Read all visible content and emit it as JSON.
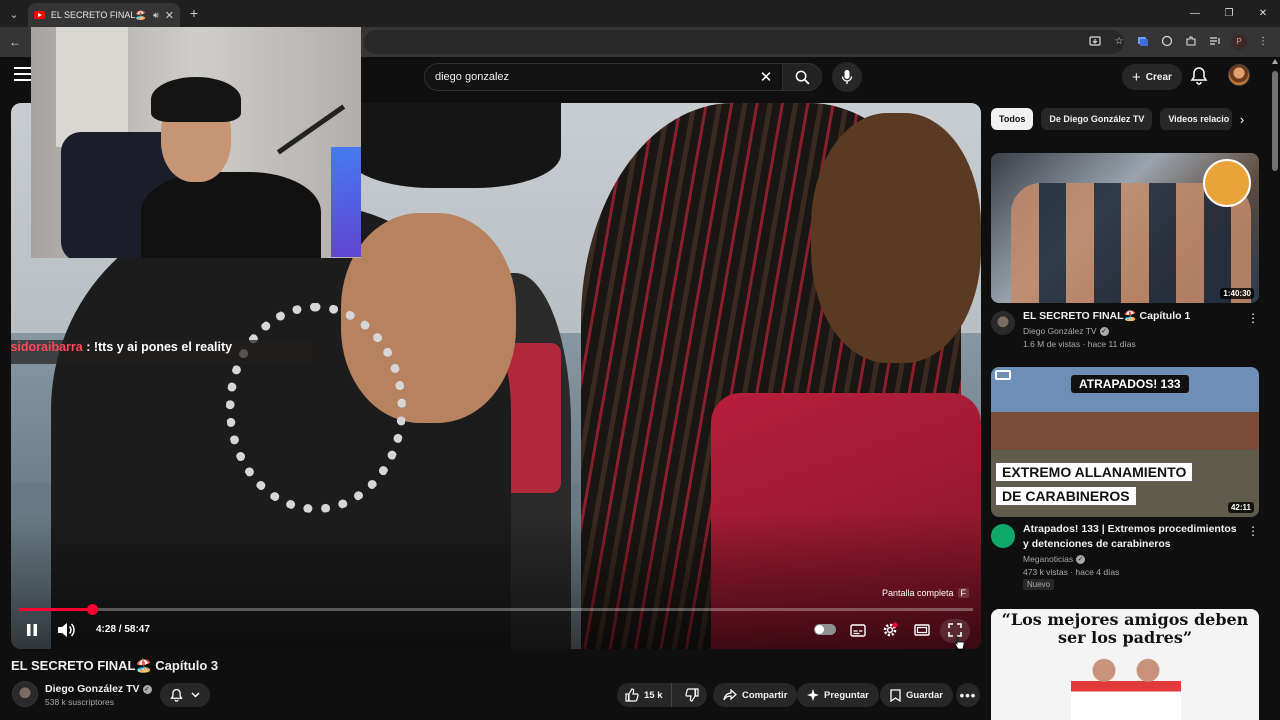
{
  "browser": {
    "tab_title": "EL SECRETO FINAL🏖️ Capítulo 3",
    "tab_list_icon": "chevron-down-icon",
    "new_tab_label": "+",
    "window_controls": [
      "—",
      "❐",
      "✕"
    ]
  },
  "header": {
    "search_value": "diego gonzalez",
    "create_label": "Crear"
  },
  "player": {
    "chat_user": "Isidoraibarra",
    "chat_message": " : !tts y ai pones el reality",
    "fullscreen_tooltip": "Pantalla completa",
    "fullscreen_key": "F",
    "time_display": "4:28 / 58:47",
    "progress_fraction": 0.0762
  },
  "video": {
    "title": "EL SECRETO FINAL🏖️ Capítulo 3",
    "channel_name": "Diego González TV",
    "subscribers": "538 k suscriptores",
    "likes": "15 k",
    "share_label": "Compartir",
    "ask_label": "Preguntar",
    "save_label": "Guardar"
  },
  "sidebar": {
    "chips": [
      "Todos",
      "De Diego González TV",
      "Videos relacio"
    ],
    "videos": [
      {
        "title": "EL SECRETO FINAL🏖️ Capítulo 1",
        "channel": "Diego González TV",
        "stats": "1.6 M de vistas · hace 11 días",
        "duration": "1:40:30"
      },
      {
        "title": "Atrapados! 133 | Extremos procedimientos y detenciones de carabineros",
        "channel": "Meganoticias",
        "stats": "473 k vistas · hace 4 días",
        "duration": "42:11",
        "badge": "Nuevo",
        "thumb_banner": "ATRAPADOS! 133",
        "thumb_line1": "EXTREMO ALLANAMIENTO",
        "thumb_line2": "DE CARABINEROS"
      },
      {
        "thumb_quote": "“Los mejores amigos deben ser los padres”"
      }
    ]
  },
  "colors": {
    "accent_red": "#ff0033",
    "background": "#0f0f0f",
    "chip_active": "#f1f1f1"
  }
}
